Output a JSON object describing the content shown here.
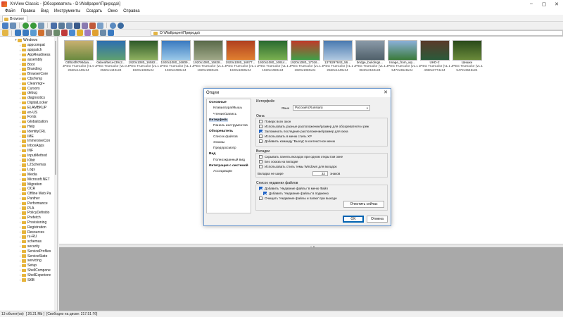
{
  "window": {
    "title": "XnView Classic - [Обозреватель - D:\\Wallpaper\\Природа\\]",
    "controls": [
      "–",
      "▢",
      "✕"
    ]
  },
  "menu": [
    "Файл",
    "Правка",
    "Вид",
    "Инструменты",
    "Создать",
    "Окно",
    "Справка"
  ],
  "tab": {
    "label": "Browser"
  },
  "address": {
    "path": "D:\\Wallpaper\\Природа\\"
  },
  "tree": {
    "root": "Windows",
    "items": [
      "appcompat",
      "apppatch",
      "AppReadiness",
      "assembly",
      "Boot",
      "Branding",
      "BrowserCore",
      "CbsTemp",
      "Cleanmgr+",
      "Cursors",
      "debug",
      "diagnostics",
      "DigitalLocker",
      "ELAMBKUP",
      "en-US",
      "Fonts",
      "Globalization",
      "Help",
      "IdentityCRL",
      "IME",
      "ImmersiveCon",
      "InboxApps",
      "INF",
      "InputMethod",
      "IObit",
      "L2Schemas",
      "Logs",
      "Media",
      "Microsoft.NET",
      "Migration",
      "OCR",
      "Offline Web Pa",
      "Panther",
      "Performance",
      "PLA",
      "PolicyDefinitio",
      "Prefetch",
      "Provisioning",
      "Registration",
      "Resources",
      "ru-RU",
      "schemas",
      "security",
      "ServiceProfiles",
      "ServiceState",
      "servicing",
      "Setup",
      "ShellCompone",
      "ShellExperienc",
      "SKB"
    ]
  },
  "thumbnails": [
    {
      "name": "03f6c6f9796daa...",
      "line1": "JPEG TrueColor (v1.0)",
      "line2": "2560x1440x24",
      "colors": [
        "#c8b070",
        "#6a8a40"
      ]
    },
    {
      "name": "0abeaf5e1ec39c2...",
      "line1": "JPEG TrueColor (v1.0)",
      "line2": "2560x1440x24",
      "colors": [
        "#2e6fb0",
        "#5fa070"
      ]
    },
    {
      "name": "1920x1080_16582...",
      "line1": "JPEG TrueColor (v1.1)",
      "line2": "1920x1080x24",
      "colors": [
        "#2f5a2a",
        "#8fb060"
      ]
    },
    {
      "name": "1920x1080_16809...",
      "line1": "JPEG TrueColor (v1.1)",
      "line2": "1920x1080x24",
      "colors": [
        "#3a7ac0",
        "#9ac8e8"
      ]
    },
    {
      "name": "1920x1080_16828...",
      "line1": "JPEG TrueColor (v1.1)",
      "line2": "1920x1080x24",
      "colors": [
        "#5a6a4a",
        "#a0a888"
      ]
    },
    {
      "name": "1920x1080_16877...",
      "line1": "JPEG TrueColor (v1.1)",
      "line2": "1920x1080x24",
      "colors": [
        "#b04020",
        "#e08030"
      ]
    },
    {
      "name": "1920x1080_16914...",
      "line1": "JPEG TrueColor (v1.1)",
      "line2": "1920x1080x24",
      "colors": [
        "#2a6a30",
        "#7ab050"
      ]
    },
    {
      "name": "1920x1080_17016...",
      "line1": "JPEG TrueColor (v1.1)",
      "line2": "1920x1080x24",
      "colors": [
        "#c03a2a",
        "#40a048"
      ]
    },
    {
      "name": "1378297843_56...",
      "line1": "JPEG TrueColor (v1.1)",
      "line2": "2560x1440x24",
      "colors": [
        "#4a7ab0",
        "#b0c8e0"
      ]
    },
    {
      "name": "bridge_buildings...",
      "line1": "JPEG TrueColor (v1.1)",
      "line2": "3840x2160x24",
      "colors": [
        "#8a9aa8",
        "#50606a"
      ]
    },
    {
      "name": "Image_from_wp...",
      "line1": "JPEG TrueColor (v1.1)",
      "line2": "5472x3648x24",
      "colors": [
        "#8ab0d8",
        "#3a7a3a"
      ]
    },
    {
      "name": "UHD-2",
      "line1": "JPEG TrueColor (v1.1)",
      "line2": "4080x2774x24",
      "colors": [
        "#5a3a2a",
        "#2a5a3a"
      ]
    },
    {
      "name": "Шишки",
      "line1": "JPEG TrueColor (v1.1)",
      "line2": "5472x3648x24",
      "colors": [
        "#2a4a1a",
        "#6a8a3a"
      ]
    }
  ],
  "status": {
    "objects": "13 объект(ов)",
    "size": "[ 26.21 Mb ]",
    "disk": "[Свободно на диске: 217.51 Гб]"
  },
  "dialog": {
    "title": "Опции",
    "nav": [
      {
        "label": "Основные",
        "group": true
      },
      {
        "label": "Клавиатура/Мышь",
        "group": false
      },
      {
        "label": "Чтение/Запись",
        "group": false
      },
      {
        "label": "Интерфейс",
        "group": true,
        "selected": true
      },
      {
        "label": "Панель инструментов",
        "group": false
      },
      {
        "label": "Обозреватель",
        "group": true
      },
      {
        "label": "Список файлов",
        "group": false
      },
      {
        "label": "Эскизы",
        "group": false
      },
      {
        "label": "Предпросмотр",
        "group": false
      },
      {
        "label": "Вид",
        "group": true
      },
      {
        "label": "Полноэкранный вид",
        "group": false
      },
      {
        "label": "Интеграция с системой",
        "group": true
      },
      {
        "label": "Ассоциации",
        "group": false
      }
    ],
    "section_title": "Интерфейс",
    "language_label": "Язык",
    "language_value": "Русский (Russian)",
    "window_group": {
      "title": "Окна",
      "options": [
        {
          "label": "Поверх всех окон",
          "checked": false
        },
        {
          "label": "Использовать разные расположение/размер для обозревателя и реж",
          "checked": false
        },
        {
          "label": "Запоминать последние расположение/размер для окна",
          "checked": true
        },
        {
          "label": "Использовать в меню стиль XP",
          "checked": false
        },
        {
          "label": "Добавить команду 'Выход' в контекстное меню",
          "checked": false
        }
      ]
    },
    "tabs_group": {
      "title": "Вкладки",
      "options": [
        {
          "label": "Скрывать панель вкладок при одном открытом окне",
          "checked": false
        },
        {
          "label": "Без эскиза на вкладке",
          "checked": false
        },
        {
          "label": "Использовать стиль темы Windows для вкладок",
          "checked": false
        }
      ],
      "width_label": "Вкладка не шире",
      "width_value": "32",
      "width_unit": "знаков"
    },
    "recent_group": {
      "title": "Список недавних файлов",
      "options": [
        {
          "label": "Добавить 'Недавние файлы' в меню Файл",
          "checked": true
        },
        {
          "label": "Добавить 'Недавние файлы' в подменю",
          "checked": true
        },
        {
          "label": "Очищать 'Недавние файлы и папки' при выходе",
          "checked": false
        }
      ],
      "clear_button": "Очистить сейчас"
    },
    "ok": "OK",
    "cancel": "Отмена"
  }
}
